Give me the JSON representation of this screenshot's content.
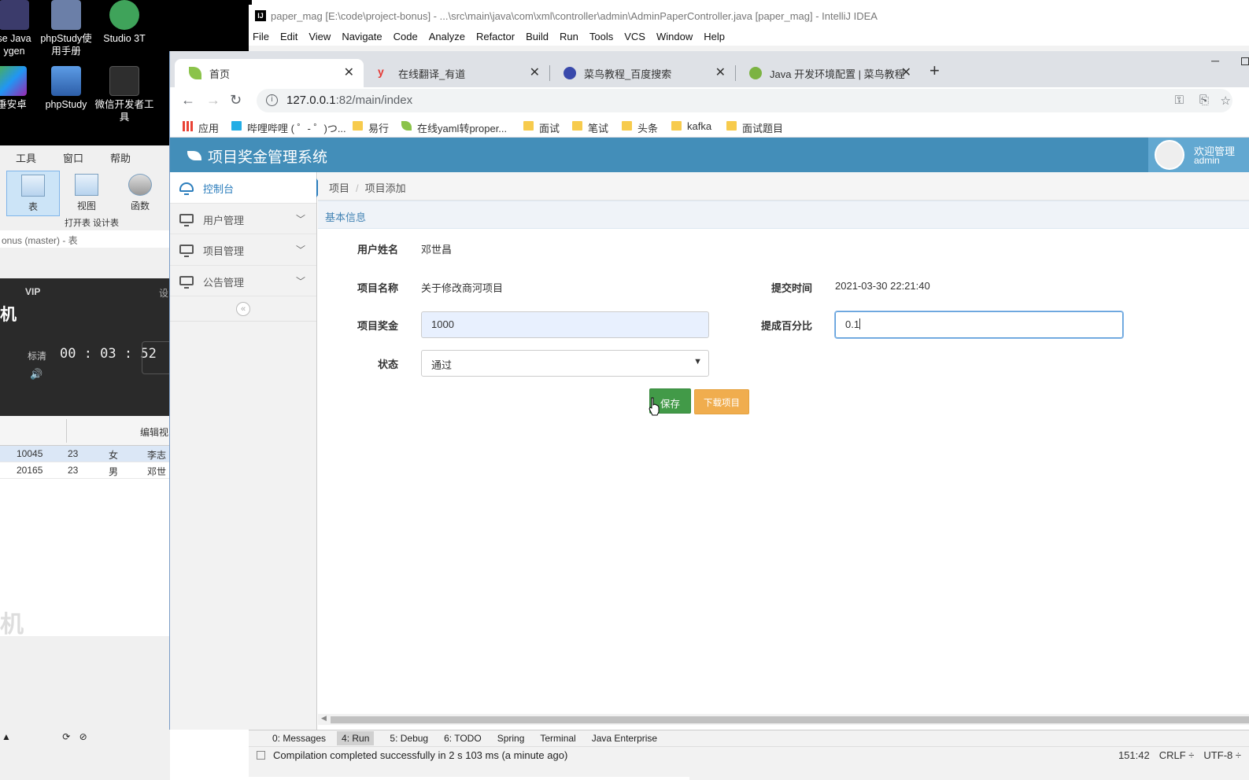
{
  "desktop": {
    "icons": [
      {
        "label": "se Java\nygen",
        "icon": "eclipse-icon"
      },
      {
        "label": "phpStudy使\n用手册",
        "icon": "help-book-icon"
      },
      {
        "label": "Studio 3T",
        "icon": "studio3t-icon"
      },
      {
        "label": "垂安卓",
        "icon": "android-icon"
      },
      {
        "label": "phpStudy",
        "icon": "phpstudy-icon"
      },
      {
        "label": "微信开发者工\n具",
        "icon": "wechat-devtools-icon"
      }
    ]
  },
  "navicat": {
    "menu": [
      "工具",
      "窗口",
      "帮助"
    ],
    "tools": [
      {
        "label": "表",
        "selected": true
      },
      {
        "label": "视图",
        "selected": false
      },
      {
        "label": "函数",
        "selected": false
      }
    ],
    "sub_tools": "打开表   设计表",
    "connection_title": "onus (master) - 表",
    "player": {
      "vip": "VIP",
      "settings": "设",
      "title": "机",
      "quality": "标清",
      "time": "00 : 03 : 52"
    },
    "grid": {
      "header": "编辑视",
      "rows": [
        [
          "10045",
          "23",
          "女",
          "李志"
        ],
        [
          "20165",
          "23",
          "男",
          "邓世"
        ]
      ]
    },
    "watermark": "机"
  },
  "intellij": {
    "title": "paper_mag [E:\\code\\project-bonus] - ...\\src\\main\\java\\com\\xml\\controller\\admin\\AdminPaperController.java [paper_mag] - IntelliJ IDEA",
    "menu": [
      "File",
      "Edit",
      "View",
      "Navigate",
      "Code",
      "Analyze",
      "Refactor",
      "Build",
      "Run",
      "Tools",
      "VCS",
      "Window",
      "Help"
    ],
    "tool_windows": [
      "0: Messages",
      "4: Run",
      "5: Debug",
      "6: TODO",
      "Spring",
      "Terminal",
      "Java Enterprise"
    ],
    "status_message": "Compilation completed successfully in 2 s 103 ms (a minute ago)",
    "cursor_pos": "151:42",
    "line_sep": "CRLF ÷",
    "encoding": "UTF-8 ÷"
  },
  "browser": {
    "tabs": [
      {
        "title": "首页",
        "active": true,
        "icon_color": "#8bc34a"
      },
      {
        "title": "在线翻译_有道",
        "active": false,
        "icon_color": "#e53935"
      },
      {
        "title": "菜鸟教程_百度搜索",
        "active": false,
        "icon_color": "#3949ab"
      },
      {
        "title": "Java 开发环境配置 | 菜鸟教程",
        "active": false,
        "icon_color": "#7cb342"
      }
    ],
    "url_host": "127.0.0.1",
    "url_path": ":82/main/index",
    "bookmarks": [
      "应用",
      "哔哩哔哩 ( ゜- ゜)つ...",
      "易行",
      "在线yaml转proper...",
      "面试",
      "笔试",
      "头条",
      "kafka",
      "面试题目"
    ]
  },
  "app": {
    "brand": "项目奖金管理系统",
    "welcome": "欢迎管理",
    "username": "admin",
    "sidebar": [
      {
        "label": "控制台",
        "active": true
      },
      {
        "label": "用户管理",
        "active": false
      },
      {
        "label": "项目管理",
        "active": false
      },
      {
        "label": "公告管理",
        "active": false
      }
    ],
    "breadcrumb": [
      "项目",
      "项目添加"
    ],
    "section_title": "基本信息",
    "form": {
      "user_name_label": "用户姓名",
      "user_name": "邓世昌",
      "project_name_label": "项目名称",
      "project_name": "关于修改商河项目",
      "submit_time_label": "提交时间",
      "submit_time": "2021-03-30 22:21:40",
      "bonus_label": "项目奖金",
      "bonus": "1000",
      "percent_label": "提成百分比",
      "percent": "0.1",
      "status_label": "状态",
      "status": "通过"
    },
    "save_button": "保存",
    "download_button": "下载项目"
  },
  "colors": {
    "header": "#438eb9",
    "save": "#429a48",
    "download": "#f0ad4e"
  }
}
